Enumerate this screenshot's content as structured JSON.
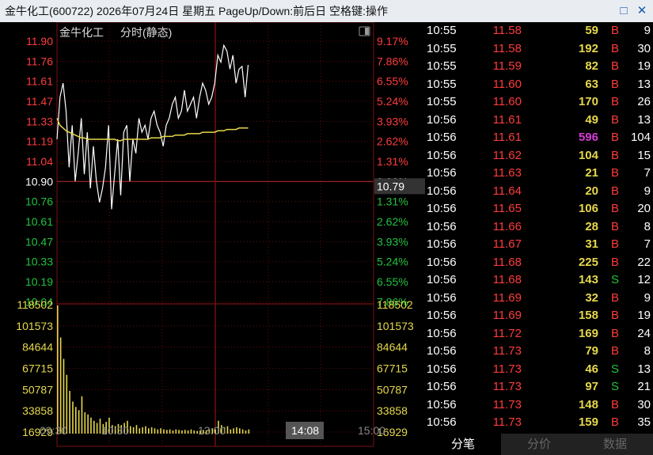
{
  "window": {
    "title": "金牛化工(600722) 2026年07月24日 星期五 PageUp/Down:前后日 空格键:操作",
    "minimize_icon": "minimize-square-icon",
    "close_icon": "close-x-icon"
  },
  "chart": {
    "stock_name": "金牛化工",
    "mode_label": "分时(静态)",
    "price_left_labels": [
      "11.90",
      "11.76",
      "11.61",
      "11.47",
      "11.33",
      "11.19",
      "11.04",
      "10.90",
      "10.76",
      "10.61",
      "10.47",
      "10.33",
      "10.19",
      "10.04"
    ],
    "pct_right_labels": [
      "9.17%",
      "7.86%",
      "6.55%",
      "5.24%",
      "3.93%",
      "2.62%",
      "1.31%",
      "0.00%",
      "1.31%",
      "2.62%",
      "3.93%",
      "5.24%",
      "6.55%",
      "7.86%"
    ],
    "volume_labels": [
      "118502",
      "101573",
      "84644",
      "67715",
      "50787",
      "33858",
      "16929"
    ],
    "x_labels": [
      "09:30",
      "10:30",
      "13:00",
      "14:08",
      "15:00"
    ],
    "cursor_price": "10.79",
    "cursor_time": "14:08",
    "colors": {
      "up": "#ff3b3b",
      "down": "#21c23e",
      "flat": "#ffffff",
      "volume": "#e6d84a",
      "avg_line": "#e6d84a",
      "price_line": "#ffffff",
      "grid": "#7a1010"
    },
    "chart_data": {
      "type": "line",
      "prev_close": 10.9,
      "ylim": [
        10.0,
        11.9
      ],
      "x_labels_ticks": [
        "09:30",
        "10:30",
        "13:00",
        "14:00",
        "15:00"
      ],
      "series": [
        {
          "values": [
            11.2,
            11.5,
            11.6,
            11.4,
            11.0,
            11.3,
            10.9,
            11.1,
            11.35,
            10.95,
            11.25,
            10.85,
            11.15,
            10.9,
            10.75,
            10.85,
            11.0,
            11.3,
            10.7,
            10.95,
            11.2,
            10.8,
            11.25,
            11.3,
            10.9,
            11.2,
            11.1,
            11.35,
            11.25,
            11.3,
            11.2,
            11.35,
            11.4,
            11.3,
            11.25,
            11.15,
            11.3,
            11.35,
            11.45,
            11.5,
            11.35,
            11.4,
            11.55,
            11.4,
            11.45,
            11.5,
            11.35,
            11.5,
            11.6,
            11.55,
            11.45,
            11.5,
            11.6,
            11.8,
            11.75,
            11.87,
            11.83,
            11.7,
            11.8,
            11.6,
            11.7,
            11.72,
            11.5,
            11.73
          ]
        },
        {
          "values": [
            11.35,
            11.3,
            11.28,
            11.26,
            11.25,
            11.24,
            11.23,
            11.22,
            11.21,
            11.21,
            11.2,
            11.2,
            11.2,
            11.2,
            11.2,
            11.2,
            11.2,
            11.2,
            11.2,
            11.2,
            11.19,
            11.19,
            11.2,
            11.2,
            11.2,
            11.2,
            11.2,
            11.2,
            11.2,
            11.2,
            11.2,
            11.21,
            11.21,
            11.21,
            11.21,
            11.22,
            11.22,
            11.22,
            11.22,
            11.23,
            11.23,
            11.23,
            11.23,
            11.24,
            11.24,
            11.24,
            11.24,
            11.24,
            11.25,
            11.25,
            11.25,
            11.25,
            11.25,
            11.26,
            11.26,
            11.26,
            11.27,
            11.27,
            11.27,
            11.27,
            11.28,
            11.28,
            11.28,
            11.28
          ]
        }
      ],
      "volume": [
        120000,
        90000,
        70000,
        55000,
        40000,
        30000,
        25000,
        22000,
        35000,
        20000,
        18000,
        15000,
        12000,
        10000,
        14000,
        9000,
        11000,
        15000,
        8000,
        7000,
        9000,
        8000,
        10000,
        12000,
        7000,
        6000,
        8000,
        5000,
        6000,
        7000,
        5000,
        6000,
        5000,
        4000,
        5000,
        4000,
        3500,
        4000,
        3000,
        4000,
        3500,
        3000,
        3500,
        3000,
        4000,
        3000,
        2500,
        3000,
        3500,
        3000,
        4000,
        5000,
        4000,
        12000,
        8000,
        6000,
        7000,
        4000,
        5000,
        6000,
        5000,
        4000,
        3000,
        4000
      ]
    }
  },
  "ticks": {
    "rows": [
      {
        "time": "10:55",
        "price": "11.58",
        "vol": "59",
        "side": "B",
        "count": "9",
        "hl": false
      },
      {
        "time": "10:55",
        "price": "11.58",
        "vol": "192",
        "side": "B",
        "count": "30",
        "hl": false
      },
      {
        "time": "10:55",
        "price": "11.59",
        "vol": "82",
        "side": "B",
        "count": "19",
        "hl": false
      },
      {
        "time": "10:55",
        "price": "11.60",
        "vol": "63",
        "side": "B",
        "count": "13",
        "hl": false
      },
      {
        "time": "10:55",
        "price": "11.60",
        "vol": "170",
        "side": "B",
        "count": "26",
        "hl": false
      },
      {
        "time": "10:56",
        "price": "11.61",
        "vol": "49",
        "side": "B",
        "count": "13",
        "hl": false
      },
      {
        "time": "10:56",
        "price": "11.61",
        "vol": "596",
        "side": "B",
        "count": "104",
        "hl": true
      },
      {
        "time": "10:56",
        "price": "11.62",
        "vol": "104",
        "side": "B",
        "count": "15",
        "hl": false
      },
      {
        "time": "10:56",
        "price": "11.63",
        "vol": "21",
        "side": "B",
        "count": "7",
        "hl": false
      },
      {
        "time": "10:56",
        "price": "11.64",
        "vol": "20",
        "side": "B",
        "count": "9",
        "hl": false
      },
      {
        "time": "10:56",
        "price": "11.65",
        "vol": "106",
        "side": "B",
        "count": "20",
        "hl": false
      },
      {
        "time": "10:56",
        "price": "11.66",
        "vol": "28",
        "side": "B",
        "count": "8",
        "hl": false
      },
      {
        "time": "10:56",
        "price": "11.67",
        "vol": "31",
        "side": "B",
        "count": "7",
        "hl": false
      },
      {
        "time": "10:56",
        "price": "11.68",
        "vol": "225",
        "side": "B",
        "count": "22",
        "hl": false
      },
      {
        "time": "10:56",
        "price": "11.68",
        "vol": "143",
        "side": "S",
        "count": "12",
        "hl": false
      },
      {
        "time": "10:56",
        "price": "11.69",
        "vol": "32",
        "side": "B",
        "count": "9",
        "hl": false
      },
      {
        "time": "10:56",
        "price": "11.69",
        "vol": "158",
        "side": "B",
        "count": "19",
        "hl": false
      },
      {
        "time": "10:56",
        "price": "11.72",
        "vol": "169",
        "side": "B",
        "count": "24",
        "hl": false
      },
      {
        "time": "10:56",
        "price": "11.73",
        "vol": "79",
        "side": "B",
        "count": "8",
        "hl": false
      },
      {
        "time": "10:56",
        "price": "11.73",
        "vol": "46",
        "side": "S",
        "count": "13",
        "hl": false
      },
      {
        "time": "10:56",
        "price": "11.73",
        "vol": "97",
        "side": "S",
        "count": "21",
        "hl": false
      },
      {
        "time": "10:56",
        "price": "11.73",
        "vol": "148",
        "side": "B",
        "count": "30",
        "hl": false
      },
      {
        "time": "10:56",
        "price": "11.73",
        "vol": "159",
        "side": "B",
        "count": "35",
        "hl": false
      }
    ],
    "highlight_color": "#d63bd6",
    "buy_color": "#ff3b3b",
    "sell_color": "#21c23e"
  },
  "tabs": [
    {
      "label": "分笔",
      "active": true
    },
    {
      "label": "分价",
      "active": false
    },
    {
      "label": "数据",
      "active": false
    }
  ]
}
